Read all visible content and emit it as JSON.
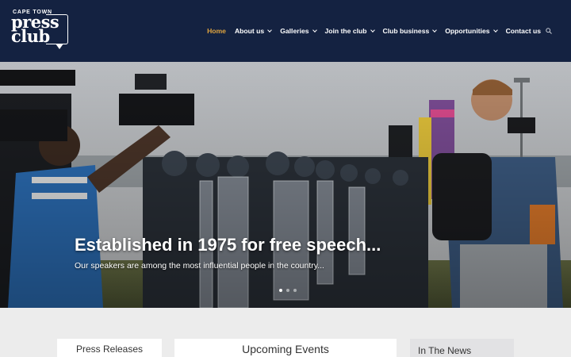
{
  "header": {
    "logo": {
      "line1": "CAPE TOWN",
      "line2": "press",
      "line3": "club"
    },
    "nav": [
      {
        "label": "Home",
        "active": true,
        "dropdown": false
      },
      {
        "label": "About us",
        "active": false,
        "dropdown": true
      },
      {
        "label": "Galleries",
        "active": false,
        "dropdown": true
      },
      {
        "label": "Join the club",
        "active": false,
        "dropdown": true
      },
      {
        "label": "Club business",
        "active": false,
        "dropdown": true
      },
      {
        "label": "Opportunities",
        "active": false,
        "dropdown": true
      },
      {
        "label": "Contact us",
        "active": false,
        "dropdown": false
      }
    ],
    "search_icon": "search-icon"
  },
  "hero": {
    "title": "Established in 1975 for free speech...",
    "subtitle": "Our speakers are among the most influential people in the country...",
    "active_slide": 1,
    "slide_count": 3
  },
  "sections": {
    "press_releases": "Press Releases",
    "upcoming_events": "Upcoming Events",
    "in_the_news": "In The News"
  },
  "colors": {
    "header_bg": "#142241",
    "accent": "#e0a43f",
    "page_bg": "#ececec"
  }
}
